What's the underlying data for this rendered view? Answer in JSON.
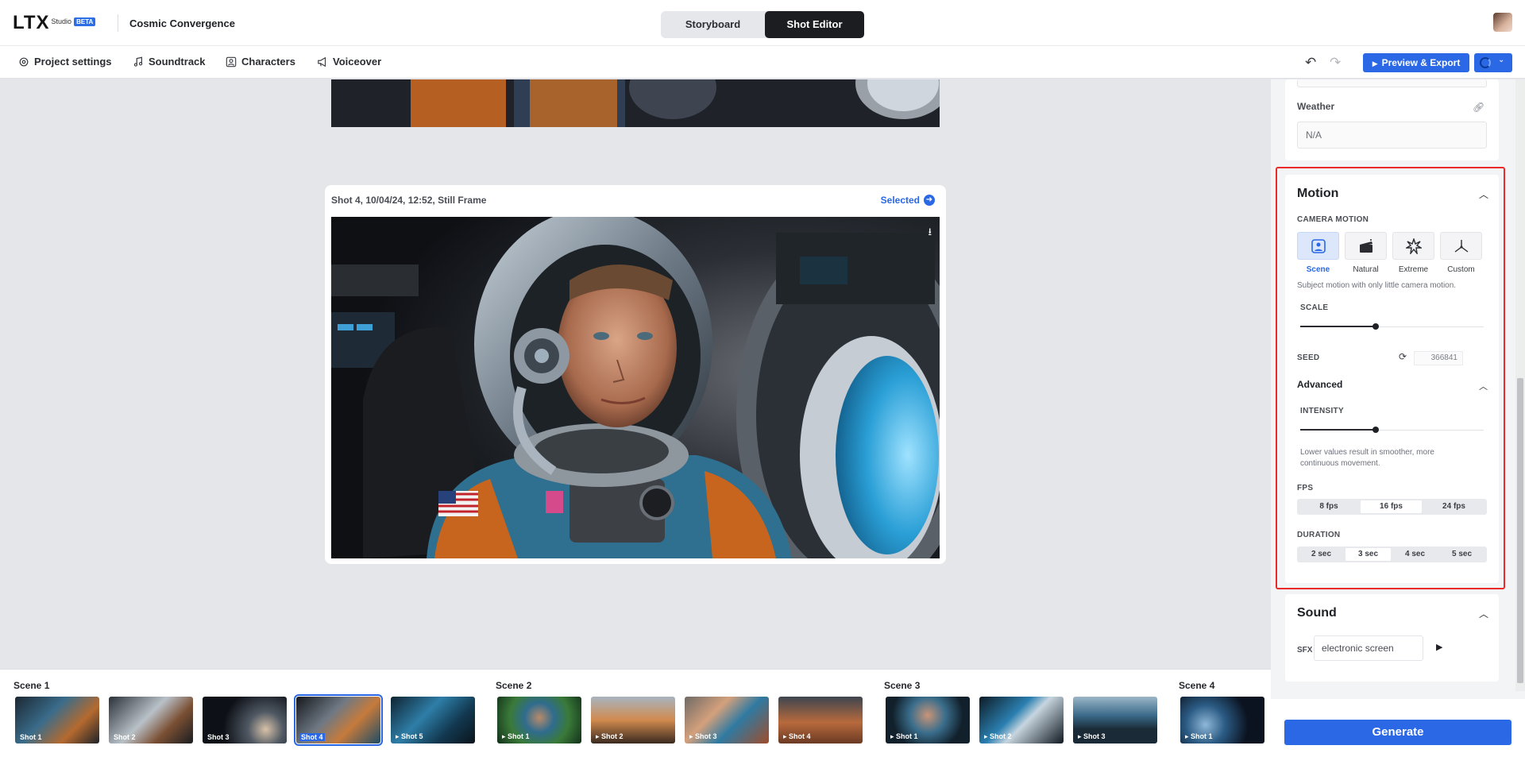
{
  "app": {
    "logo": "LTX",
    "logo_sub": "Studio",
    "logo_badge": "BETA",
    "project_title": "Cosmic Convergence"
  },
  "mode_toggle": {
    "storyboard": "Storyboard",
    "shot_editor": "Shot Editor",
    "active": "Shot Editor"
  },
  "subnav": {
    "items": [
      {
        "label": "Project settings",
        "icon": "gear-icon"
      },
      {
        "label": "Soundtrack",
        "icon": "music-note-icon"
      },
      {
        "label": "Characters",
        "icon": "person-icon"
      },
      {
        "label": "Voiceover",
        "icon": "megaphone-icon"
      }
    ],
    "export_label": "Preview & Export"
  },
  "shot": {
    "title": "Shot 4, 10/04/24, 12:52, Still Frame",
    "selected_label": "Selected"
  },
  "timeline": {
    "scenes": [
      {
        "label": "Scene 1",
        "shots": [
          "Shot 1",
          "Shot 2",
          "Shot 3",
          "Shot 4",
          "Shot 5"
        ]
      },
      {
        "label": "Scene 2",
        "shots": [
          "Shot 1",
          "Shot 2",
          "Shot 3",
          "Shot 4"
        ]
      },
      {
        "label": "Scene 3",
        "shots": [
          "Shot 1",
          "Shot 2",
          "Shot 3"
        ]
      },
      {
        "label": "Scene 4",
        "shots": [
          "Shot 1"
        ]
      }
    ],
    "selected": {
      "scene": "Scene 1",
      "shot": "Shot 4"
    }
  },
  "panel": {
    "weather": {
      "label": "Weather",
      "value": "N/A"
    },
    "motion": {
      "title": "Motion",
      "camera_motion_label": "CAMERA MOTION",
      "options": [
        {
          "label": "Scene",
          "icon": "scene-person-icon"
        },
        {
          "label": "Natural",
          "icon": "clapperboard-icon"
        },
        {
          "label": "Extreme",
          "icon": "burst-icon"
        },
        {
          "label": "Custom",
          "icon": "axes-icon"
        }
      ],
      "active_option": "Scene",
      "description": "Subject motion with only little camera motion.",
      "scale_label": "SCALE",
      "scale_value": 0.5,
      "seed_label": "SEED",
      "seed_value": "366841",
      "advanced_label": "Advanced",
      "intensity_label": "INTENSITY",
      "intensity_value": 0.5,
      "intensity_help": "Lower values result in smoother, more continuous movement.",
      "fps_label": "FPS",
      "fps_options": [
        "8 fps",
        "16 fps",
        "24 fps"
      ],
      "fps_active": "16 fps",
      "duration_label": "DURATION",
      "duration_options": [
        "2 sec",
        "3 sec",
        "4 sec",
        "5 sec"
      ],
      "duration_active": "3 sec"
    },
    "sound": {
      "title": "Sound",
      "sfx_label": "SFX",
      "sfx_value": "electronic screen"
    },
    "generate_label": "Generate"
  },
  "colors": {
    "accent": "#2a68e6",
    "highlight": "#ea2a2a"
  }
}
